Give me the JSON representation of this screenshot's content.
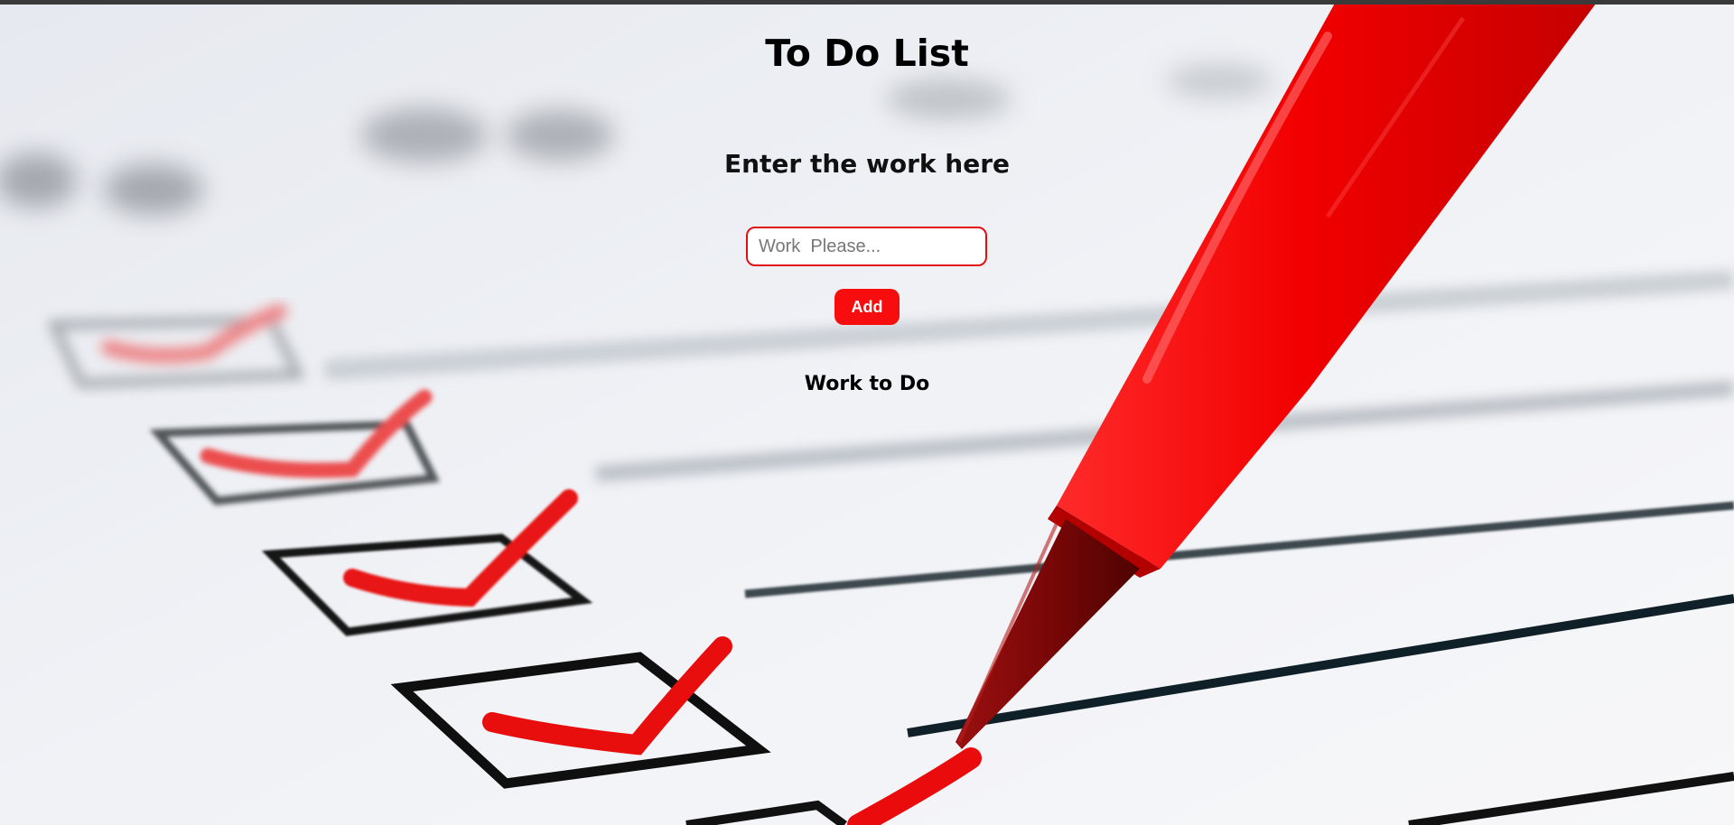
{
  "app": {
    "title": "To Do List"
  },
  "form": {
    "heading": "Enter the work here",
    "input_placeholder": "Work  Please...",
    "input_value": "",
    "add_label": "Add"
  },
  "tasks": {
    "heading": "Work to Do",
    "items": []
  },
  "colors": {
    "accent": "#f70d0d",
    "input_border": "#e01010",
    "topbar": "#3a3a3a",
    "paper": "#eef0f4"
  },
  "icons": {
    "background": "checklist-with-red-pen-photo"
  }
}
